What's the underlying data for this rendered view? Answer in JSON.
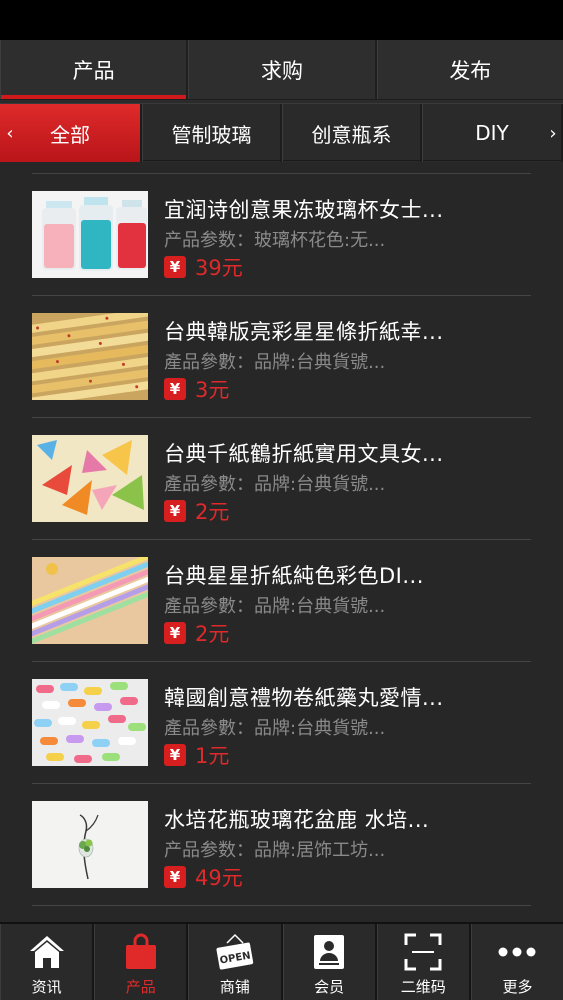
{
  "top_tabs": [
    {
      "label": "产品",
      "active": true
    },
    {
      "label": "求购",
      "active": false
    },
    {
      "label": "发布",
      "active": false
    }
  ],
  "categories": {
    "prev_arrow": "‹",
    "next_arrow": "›",
    "items": [
      {
        "label": "全部",
        "active": true
      },
      {
        "label": "管制玻璃",
        "active": false
      },
      {
        "label": "创意瓶系",
        "active": false
      },
      {
        "label": "DIY",
        "active": false
      }
    ]
  },
  "products": [
    {
      "title": "宜润诗创意果冻玻璃杯女士...",
      "params": "产品参数：玻璃杯花色:无...",
      "yen": "¥",
      "price": "39元"
    },
    {
      "title": "台典韓版亮彩星星條折紙幸...",
      "params": "產品參數：品牌:台典貨號...",
      "yen": "¥",
      "price": "3元"
    },
    {
      "title": "台典千紙鶴折紙實用文具女...",
      "params": "產品參數：品牌:台典貨號...",
      "yen": "¥",
      "price": "2元"
    },
    {
      "title": "台典星星折紙純色彩色DI...",
      "params": "產品參數：品牌:台典貨號...",
      "yen": "¥",
      "price": "2元"
    },
    {
      "title": "韓國創意禮物卷紙藥丸愛情...",
      "params": "產品參數：品牌:台典貨號...",
      "yen": "¥",
      "price": "1元"
    },
    {
      "title": "水培花瓶玻璃花盆鹿 水培...",
      "params": "产品参数：品牌:居饰工坊...",
      "yen": "¥",
      "price": "49元"
    }
  ],
  "bottom_nav": [
    {
      "label": "资讯",
      "icon": "home-icon",
      "active": false
    },
    {
      "label": "产品",
      "icon": "shopping-bag-icon",
      "active": true
    },
    {
      "label": "商铺",
      "icon": "open-sign-icon",
      "active": false,
      "icon_text": "OPEN"
    },
    {
      "label": "会员",
      "icon": "member-card-icon",
      "active": false
    },
    {
      "label": "二维码",
      "icon": "qr-scan-icon",
      "active": false
    },
    {
      "label": "更多",
      "icon": "more-dots-icon",
      "active": false
    }
  ],
  "colors": {
    "accent": "#d0191b",
    "background": "#2b2b2b",
    "price": "#e0292a",
    "muted_text": "#8a8a8a"
  }
}
